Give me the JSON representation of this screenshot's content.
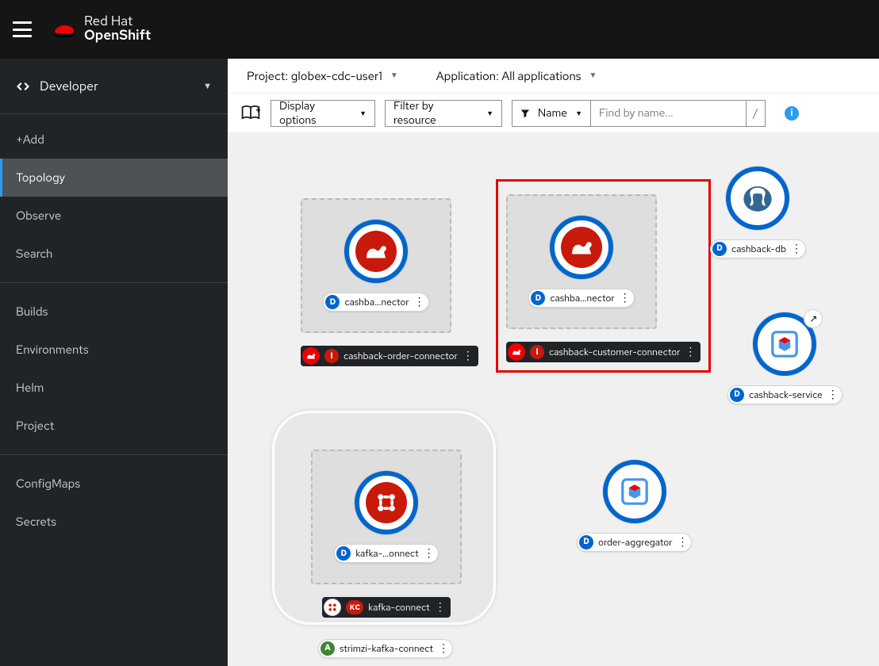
{
  "brand": {
    "line1": "Red Hat",
    "line2": "OpenShift"
  },
  "perspective": {
    "label": "Developer"
  },
  "sidebar": {
    "groups": [
      {
        "items": [
          {
            "label": "+Add"
          },
          {
            "label": "Topology",
            "active": true
          },
          {
            "label": "Observe"
          },
          {
            "label": "Search"
          }
        ]
      },
      {
        "items": [
          {
            "label": "Builds"
          },
          {
            "label": "Environments"
          },
          {
            "label": "Helm"
          },
          {
            "label": "Project"
          }
        ]
      },
      {
        "items": [
          {
            "label": "ConfigMaps"
          },
          {
            "label": "Secrets"
          }
        ]
      }
    ]
  },
  "toolbar1": {
    "project_prefix": "Project: ",
    "project": "globex-cdc-user1",
    "application_prefix": "Application: ",
    "application": "All applications"
  },
  "toolbar2": {
    "display": "Display options",
    "filter": "Filter by resource",
    "name": "Name",
    "search_placeholder": "Find by name...",
    "slash": "/"
  },
  "colors": {
    "brand_red": "#ee0000",
    "ring_blue": "#0066cc",
    "postgres_blue": "#336791",
    "quarkus_blue": "#4695eb"
  },
  "nodes": {
    "cashback_order": {
      "inner_badge": "D",
      "inner_label": "cashba…nector",
      "outer_badge": "I",
      "outer_label": "cashback-order-connector"
    },
    "cashback_customer": {
      "inner_badge": "D",
      "inner_label": "cashba…nector",
      "outer_badge": "I",
      "outer_label": "cashback-customer-connector"
    },
    "kafka": {
      "inner_badge": "D",
      "inner_label": "kafka-…onnect",
      "mid_badge": "KC",
      "mid_label": "kafka-connect",
      "outer_badge": "A",
      "outer_label": "strimzi-kafka-connect"
    },
    "cashback_db": {
      "badge": "D",
      "label": "cashback-db"
    },
    "cashback_service": {
      "badge": "D",
      "label": "cashback-service"
    },
    "order_agg": {
      "badge": "D",
      "label": "order-aggregator"
    }
  }
}
